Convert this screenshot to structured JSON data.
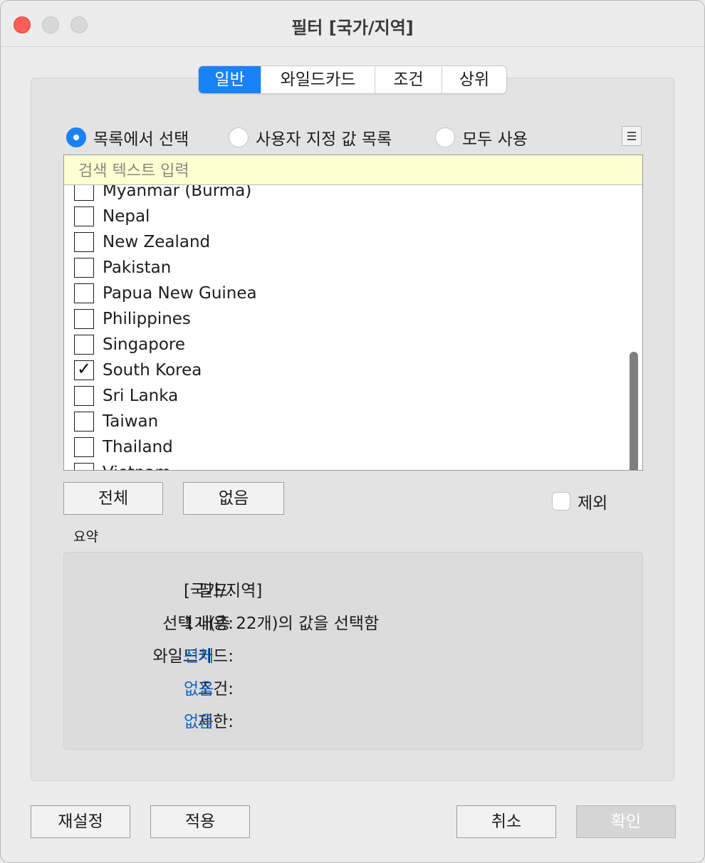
{
  "window": {
    "title": "필터 [국가/지역]"
  },
  "tabs": [
    {
      "label": "일반",
      "active": true
    },
    {
      "label": "와일드카드",
      "active": false
    },
    {
      "label": "조건",
      "active": false
    },
    {
      "label": "상위",
      "active": false
    }
  ],
  "mode": {
    "options": [
      {
        "label": "목록에서 선택",
        "selected": true
      },
      {
        "label": "사용자 지정 값 목록",
        "selected": false
      },
      {
        "label": "모두 사용",
        "selected": false
      }
    ]
  },
  "search": {
    "placeholder": "검색 텍스트 입력",
    "value": ""
  },
  "list": {
    "items": [
      {
        "label": "Myanmar (Burma)",
        "checked": false
      },
      {
        "label": "Nepal",
        "checked": false
      },
      {
        "label": "New Zealand",
        "checked": false
      },
      {
        "label": "Pakistan",
        "checked": false
      },
      {
        "label": "Papua New Guinea",
        "checked": false
      },
      {
        "label": "Philippines",
        "checked": false
      },
      {
        "label": "Singapore",
        "checked": false
      },
      {
        "label": "South Korea",
        "checked": true
      },
      {
        "label": "Sri Lanka",
        "checked": false
      },
      {
        "label": "Taiwan",
        "checked": false
      },
      {
        "label": "Thailand",
        "checked": false
      },
      {
        "label": "Vietnam",
        "checked": false
      }
    ]
  },
  "selection_buttons": {
    "all_label": "전체",
    "none_label": "없음"
  },
  "exclude": {
    "label": "제외",
    "checked": false
  },
  "summary": {
    "title": "요약",
    "rows": [
      {
        "key": "필드:",
        "value": "[국가/지역]",
        "link": false
      },
      {
        "key": "선택 내용:",
        "value": "1개(총 22개)의 값을 선택함",
        "link": false
      },
      {
        "key": "와일드카드:",
        "value": "전체",
        "link": true
      },
      {
        "key": "조건:",
        "value": "없음",
        "link": true
      },
      {
        "key": "제한:",
        "value": "없음",
        "link": true
      }
    ]
  },
  "footer": {
    "reset_label": "재설정",
    "apply_label": "적용",
    "cancel_label": "취소",
    "ok_label": "확인"
  },
  "colors": {
    "accent": "#1a82f7",
    "search_bg": "#ffffd3",
    "link": "#1767c9"
  }
}
